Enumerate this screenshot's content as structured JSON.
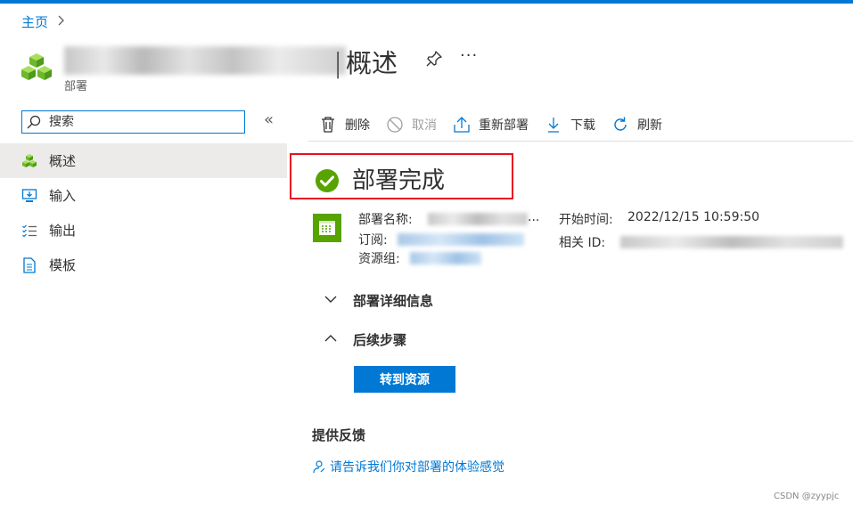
{
  "colors": {
    "accent": "#0078d4",
    "success": "#57a300",
    "highlight_border": "#e81123"
  },
  "breadcrumb": {
    "home": "主页",
    "chevron_icon": "chevron-right-icon"
  },
  "header": {
    "title": "概述",
    "type": "部署",
    "separator": "|",
    "more": "···",
    "icon": "resource-group-cubes-icon"
  },
  "search": {
    "placeholder": "搜索",
    "value": ""
  },
  "sidebar": {
    "collapse": "«",
    "items": [
      {
        "label": "概述",
        "icon": "overview-cubes-icon",
        "active": true
      },
      {
        "label": "输入",
        "icon": "monitor-input-icon",
        "active": false
      },
      {
        "label": "输出",
        "icon": "list-output-icon",
        "active": false
      },
      {
        "label": "模板",
        "icon": "document-template-icon",
        "active": false
      }
    ]
  },
  "toolbar": {
    "delete": "删除",
    "cancel": "取消",
    "redeploy": "重新部署",
    "download": "下载",
    "refresh": "刷新"
  },
  "status": {
    "text": "部署完成",
    "icon": "check-circle-icon"
  },
  "details": {
    "deployment_name_label": "部署名称:",
    "deployment_name_suffix": "...",
    "subscription_label": "订阅:",
    "resource_group_label": "资源组:",
    "start_time_label": "开始时间:",
    "start_time_value": "2022/12/15 10:59:50",
    "correlation_id_label": "相关 ID:"
  },
  "sections": {
    "details": {
      "label": "部署详细信息",
      "expanded": false
    },
    "next_steps": {
      "label": "后续步骤",
      "expanded": true
    }
  },
  "go_to_resource": "转到资源",
  "feedback": {
    "title": "提供反馈",
    "link": "请告诉我们你对部署的体验感觉"
  },
  "watermark": "CSDN @zyypjc"
}
